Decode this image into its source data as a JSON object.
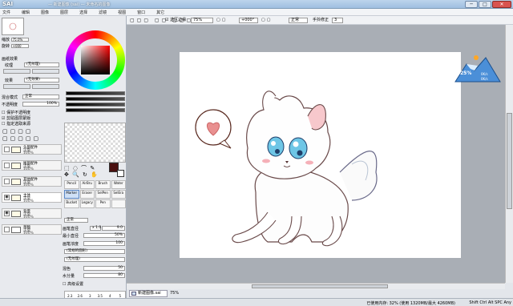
{
  "window": {
    "app_title": "SAI",
    "subtitle": "— 新建图像 (sai) — 未命名的图像",
    "buttons": [
      "─",
      "□",
      "✕"
    ],
    "restore_label": "重置工作区"
  },
  "menu": {
    "items": [
      "文件",
      "编辑",
      "图像",
      "图层",
      "选择",
      "滤镜",
      "视图",
      "窗口",
      "其它"
    ],
    "right_text": "还原工作区"
  },
  "navigator": {
    "zoom_label": "缩放",
    "zoom_value": "75.0%",
    "rotate_label": "旋转",
    "rotate_value": "+000"
  },
  "layer_props": {
    "effects_title": "画纸效果",
    "texture_label": "纹理",
    "texture_value": "(无纹理)",
    "effect_label": "效果",
    "effect_value": "(无效果)",
    "blend_label": "混合模式",
    "blend_value": "正常",
    "opacity_label": "不透明度",
    "opacity_value": "100%",
    "checkboxes": [
      "保护不透明度",
      "剪贴图层蒙版",
      "指定选取来源"
    ]
  },
  "layers": [
    {
      "name": "头部配件",
      "mode": "正常",
      "opacity": "100%"
    },
    {
      "name": "尾部配件",
      "mode": "正常",
      "opacity": "100%"
    },
    {
      "name": "其他配件",
      "mode": "正常",
      "opacity": "100%"
    },
    {
      "name": "主体",
      "mode": "正常",
      "opacity": "100%"
    },
    {
      "name": "背景",
      "mode": "正常",
      "opacity": "100%"
    },
    {
      "name": "草稿",
      "mode": "正常",
      "opacity": "100%"
    }
  ],
  "tools": {
    "cells": [
      "Pencil",
      "AirBru",
      "Brush",
      "Water",
      "Marker",
      "Eraser",
      "SelPen",
      "SelEra",
      "Bucket",
      "Legacy",
      "Pen",
      ""
    ],
    "active_index": 4
  },
  "brush_settings": {
    "mode": "正常",
    "size_label": "画笔直径",
    "size_mult": "x 1.0",
    "size_value": "9.0",
    "min_size_label": "最小直径",
    "min_size_value": "50%",
    "density_label": "画笔浓度",
    "density_value": "100",
    "shape_value": "(常规的圆形)",
    "texture_value": "(无纹理)",
    "blend_label": "混色",
    "blend_value": "50",
    "dilution_label": "水分量",
    "dilution_value": "80",
    "advanced_label": "高级设置",
    "dot_sizes": [
      "2.3",
      "2.6",
      "3",
      "3.5",
      "4",
      "5",
      "6",
      "7",
      "8",
      "9",
      "10",
      "12"
    ]
  },
  "toolbar": {
    "checkbox_label": "选区边缘",
    "zoom_value": "75%",
    "rotate_value": "+000°",
    "mode_value": "正常",
    "stabilizer_label": "手抖修正",
    "stabilizer_value": "3"
  },
  "document": {
    "tab_label": "新建图像.sai",
    "tab_zoom": "75%"
  },
  "status": {
    "memory": "已使用内存: 32% (使用 1320MB/最大 4260MB)",
    "keys": "Shift Ctrl Alt SPC Any"
  },
  "widget": {
    "percent": "25%",
    "line1": "0K/s",
    "line2": "0K/s"
  },
  "colors": {
    "accent": "#5a86c4",
    "primary_color": "#4a1010",
    "titlebar": "#9fbfe0"
  }
}
